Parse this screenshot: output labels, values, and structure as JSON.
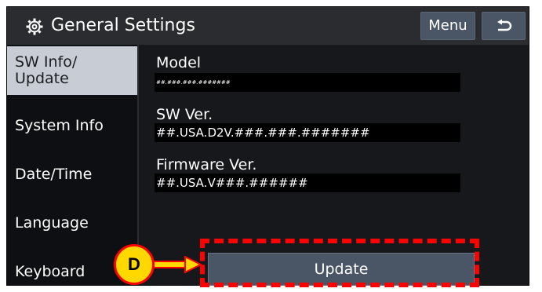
{
  "header": {
    "icon": "gear-icon",
    "title": "General Settings",
    "menu_label": "Menu",
    "back_icon": "back-arrow-icon"
  },
  "sidebar": {
    "items": [
      {
        "label": "SW Info/\nUpdate",
        "active": true
      },
      {
        "label": "System Info",
        "active": false
      },
      {
        "label": "Date/Time",
        "active": false
      },
      {
        "label": "Language",
        "active": false
      },
      {
        "label": "Keyboard",
        "active": false
      }
    ]
  },
  "content": {
    "model_label": "Model",
    "model_value": "##.###.###.#######",
    "sw_label": "SW Ver.",
    "sw_value": "##.USA.D2V.###.###.#######",
    "fw_label": "Firmware Ver.",
    "fw_value": "##.USA.V###.######"
  },
  "update_label": "Update",
  "annotation": {
    "callout_letter": "D",
    "highlight_color": "#ff0000",
    "callout_color": "#ffd800"
  }
}
